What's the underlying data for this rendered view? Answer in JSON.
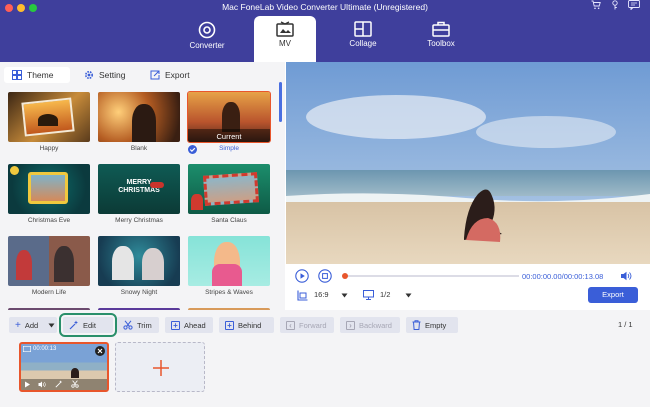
{
  "app": {
    "title": "Mac FoneLab Video Converter Ultimate (Unregistered)"
  },
  "nav": {
    "converter": "Converter",
    "mv": "MV",
    "collage": "Collage",
    "toolbox": "Toolbox"
  },
  "subtabs": {
    "theme": "Theme",
    "setting": "Setting",
    "export": "Export"
  },
  "themes": [
    {
      "name": "Happy"
    },
    {
      "name": "Blank"
    },
    {
      "name": "Simple",
      "badge": "Current",
      "selected": true
    },
    {
      "name": "Christmas Eve"
    },
    {
      "name": "Merry Christmas"
    },
    {
      "name": "Santa Claus"
    },
    {
      "name": "Modern Life"
    },
    {
      "name": "Snowy Night"
    },
    {
      "name": "Stripes & Waves"
    }
  ],
  "theme_card_text": {
    "merry_line1": "MERRY",
    "merry_line2": "CHRISTMAS"
  },
  "player": {
    "time": "00:00:00.00/00:00:13.08",
    "progress": 0.0
  },
  "controls": {
    "aspect": "16:9",
    "page": "1/2",
    "export_button": "Export"
  },
  "toolbar": {
    "add": "Add",
    "edit": "Edit",
    "trim": "Trim",
    "ahead": "Ahead",
    "behind": "Behind",
    "forward": "Forward",
    "backward": "Backward",
    "empty": "Empty",
    "page_count": "1 / 1"
  },
  "clip": {
    "duration": "00:00:13"
  },
  "colors": {
    "brand": "#3f3f9c",
    "accent": "#e8562c",
    "selected": "#3a5ed8",
    "highlight": "#2a8f6a"
  }
}
